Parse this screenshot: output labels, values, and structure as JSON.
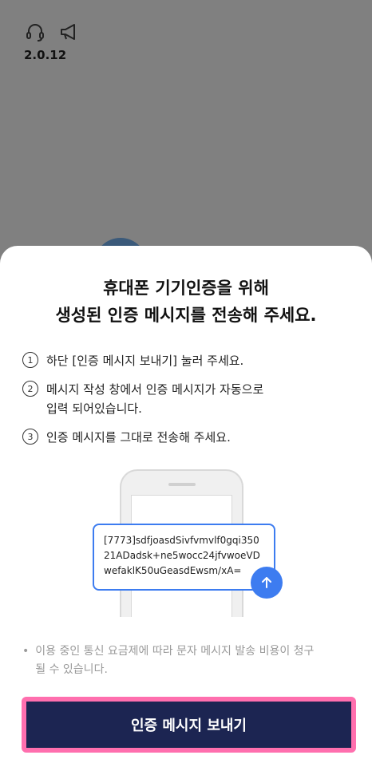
{
  "header": {
    "icons": [
      "headset-icon",
      "megaphone-icon"
    ],
    "version": "2.0.12"
  },
  "sheet": {
    "title_line1": "휴대폰 기기인증을 위해",
    "title_line2": "생성된 인증 메시지를 전송해 주세요.",
    "steps": [
      {
        "num": "1",
        "text": "하단 [인증 메시지 보내기] 눌러 주세요."
      },
      {
        "num": "2",
        "text": "메시지 작성 창에서 인증 메시지가 자동으로\n입력 되어있습니다."
      },
      {
        "num": "3",
        "text": "인증 메시지를 그대로 전송해 주세요."
      }
    ],
    "message_preview": "[7773]sdfjoasdSivfvmvlf0gqi35021ADadsk+ne5wocc24jfvwoeVDwefaklK50uGeasdEwsm/xA=",
    "notice": "이용 중인 통신 요금제에 따라 문자 메시지 발송 비용이 청구\n될 수 있습니다.",
    "cta_label": "인증 메시지 보내기"
  },
  "colors": {
    "overlay": "#808080",
    "primary": "#1c2552",
    "accent_blue": "#3d7cf0",
    "highlight": "#ff6fae"
  }
}
